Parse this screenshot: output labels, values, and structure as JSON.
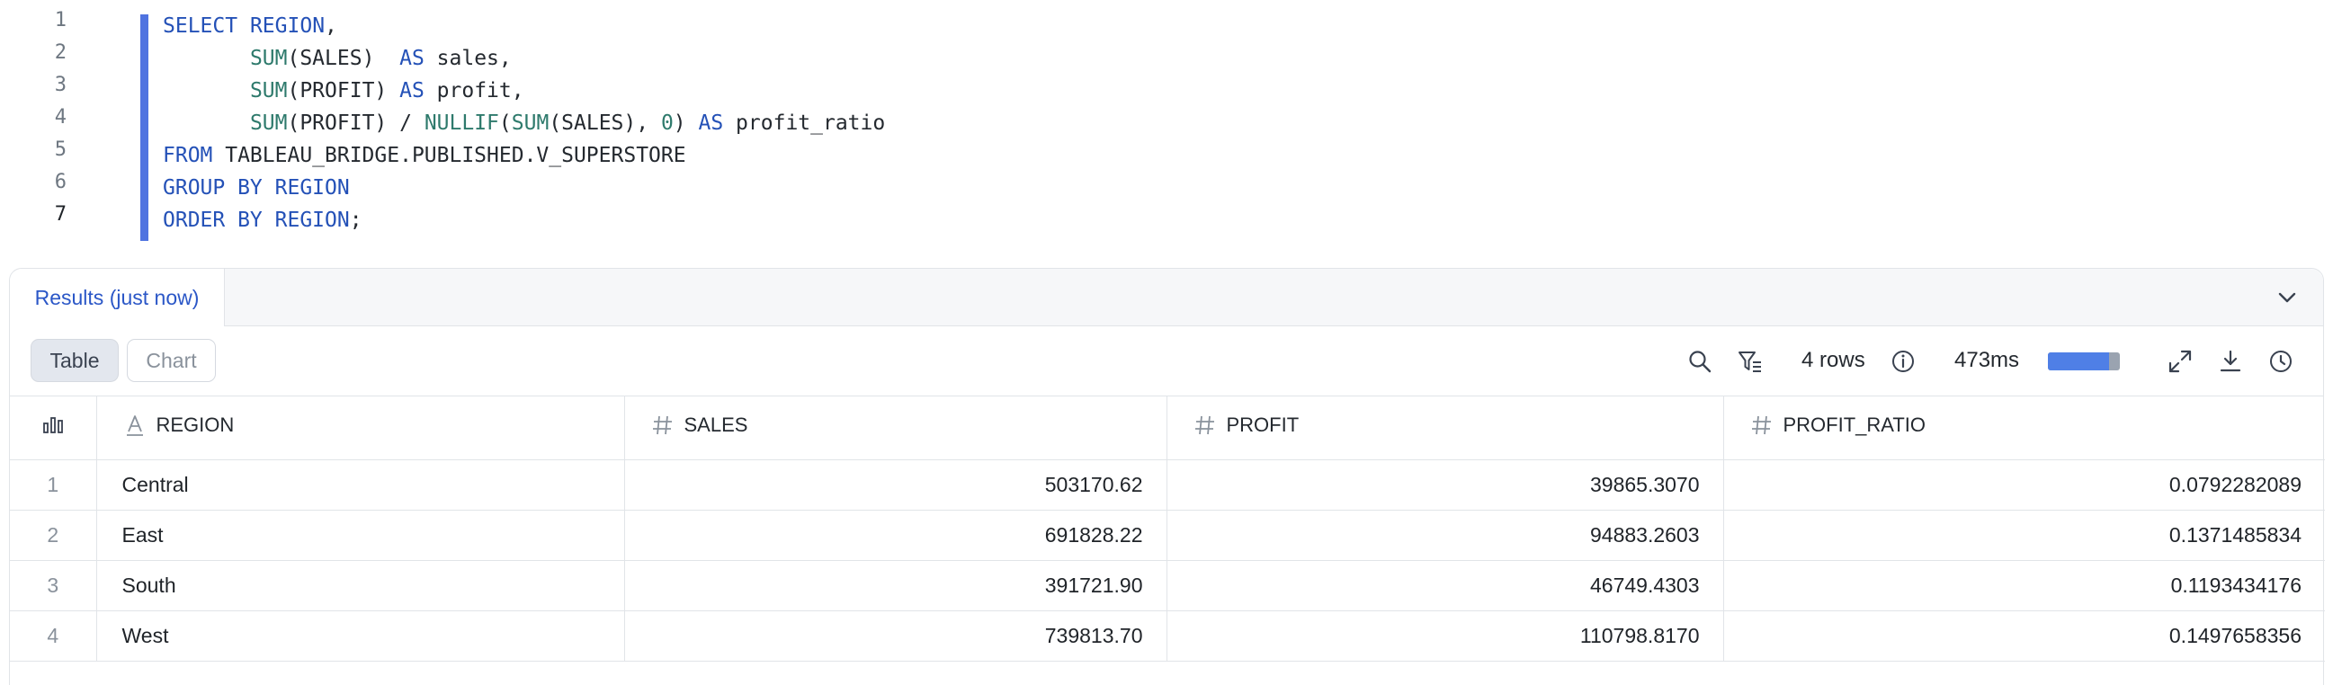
{
  "editor": {
    "line_numbers": [
      "1",
      "2",
      "3",
      "4",
      "5",
      "6",
      "7"
    ],
    "active_line": "7",
    "lines": [
      [
        {
          "t": "kw",
          "v": "SELECT"
        },
        {
          "t": "p",
          "v": " "
        },
        {
          "t": "kw",
          "v": "REGION"
        },
        {
          "t": "p",
          "v": ","
        }
      ],
      [
        {
          "t": "p",
          "v": "       "
        },
        {
          "t": "fn",
          "v": "SUM"
        },
        {
          "t": "p",
          "v": "(SALES)  "
        },
        {
          "t": "kw",
          "v": "AS"
        },
        {
          "t": "p",
          "v": " sales,"
        }
      ],
      [
        {
          "t": "p",
          "v": "       "
        },
        {
          "t": "fn",
          "v": "SUM"
        },
        {
          "t": "p",
          "v": "(PROFIT) "
        },
        {
          "t": "kw",
          "v": "AS"
        },
        {
          "t": "p",
          "v": " profit,"
        }
      ],
      [
        {
          "t": "p",
          "v": "       "
        },
        {
          "t": "fn",
          "v": "SUM"
        },
        {
          "t": "p",
          "v": "(PROFIT) / "
        },
        {
          "t": "fn",
          "v": "NULLIF"
        },
        {
          "t": "p",
          "v": "("
        },
        {
          "t": "fn",
          "v": "SUM"
        },
        {
          "t": "p",
          "v": "(SALES), "
        },
        {
          "t": "num",
          "v": "0"
        },
        {
          "t": "p",
          "v": ") "
        },
        {
          "t": "kw",
          "v": "AS"
        },
        {
          "t": "p",
          "v": " profit_ratio"
        }
      ],
      [
        {
          "t": "kw",
          "v": "FROM"
        },
        {
          "t": "p",
          "v": " TABLEAU_BRIDGE.PUBLISHED.V_SUPERSTORE"
        }
      ],
      [
        {
          "t": "kw",
          "v": "GROUP BY"
        },
        {
          "t": "p",
          "v": " "
        },
        {
          "t": "kw",
          "v": "REGION"
        }
      ],
      [
        {
          "t": "kw",
          "v": "ORDER BY"
        },
        {
          "t": "p",
          "v": " "
        },
        {
          "t": "kw",
          "v": "REGION"
        },
        {
          "t": "p",
          "v": ";"
        }
      ]
    ]
  },
  "results": {
    "tab_label": "Results (just now)",
    "view_toggle": {
      "table_label": "Table",
      "chart_label": "Chart",
      "selected": "Table"
    },
    "row_count": "4 rows",
    "duration": "473ms",
    "progress_fraction": 0.85,
    "icons": [
      "search-icon",
      "filter-icon",
      "info-icon",
      "expand-icon",
      "download-icon",
      "history-icon",
      "chevron-down-icon"
    ]
  },
  "table": {
    "columns": [
      {
        "label": "REGION",
        "type": "text"
      },
      {
        "label": "SALES",
        "type": "number"
      },
      {
        "label": "PROFIT",
        "type": "number"
      },
      {
        "label": "PROFIT_RATIO",
        "type": "number"
      }
    ],
    "rows": [
      {
        "idx": "1",
        "region": "Central",
        "sales": "503170.62",
        "profit": "39865.3070",
        "profit_ratio": "0.0792282089"
      },
      {
        "idx": "2",
        "region": "East",
        "sales": "691828.22",
        "profit": "94883.2603",
        "profit_ratio": "0.1371485834"
      },
      {
        "idx": "3",
        "region": "South",
        "sales": "391721.90",
        "profit": "46749.4303",
        "profit_ratio": "0.1193434176"
      },
      {
        "idx": "4",
        "region": "West",
        "sales": "739813.70",
        "profit": "110798.8170",
        "profit_ratio": "0.1497658356"
      }
    ]
  },
  "colors": {
    "accent": "#4f73e0",
    "keyword": "#2451b7",
    "function": "#2e7a6c",
    "tab_active_text": "#2b57c7"
  }
}
